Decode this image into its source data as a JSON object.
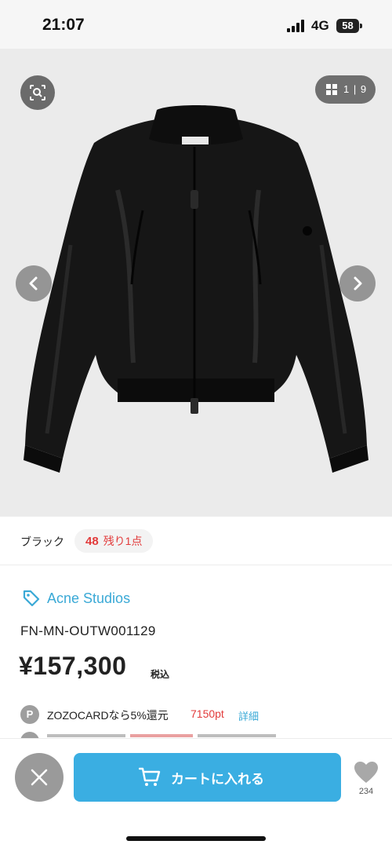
{
  "status_bar": {
    "time": "21:07",
    "network": "4G",
    "battery": "58"
  },
  "gallery": {
    "counter": "1 | 9",
    "icons": [
      "image-search-icon",
      "grid-icon",
      "chevron-left-icon",
      "chevron-right-icon"
    ]
  },
  "variant": {
    "color": "ブラック",
    "size": "48",
    "stock": "残り1点"
  },
  "product": {
    "brand": "Acne Studios",
    "code": "FN-MN-OUTW001129",
    "price": "¥157,300",
    "tax_label": "税込"
  },
  "points": {
    "icon_letter": "P",
    "text": "ZOZOCARDなら5%還元",
    "value": "7150pt",
    "detail_link": "詳細"
  },
  "bottom_bar": {
    "cart_label": "カートに入れる",
    "favorite_count": "234"
  },
  "colors": {
    "accent": "#3aaee2",
    "brand_link": "#3aa9d6",
    "alert": "#e23b3b"
  }
}
